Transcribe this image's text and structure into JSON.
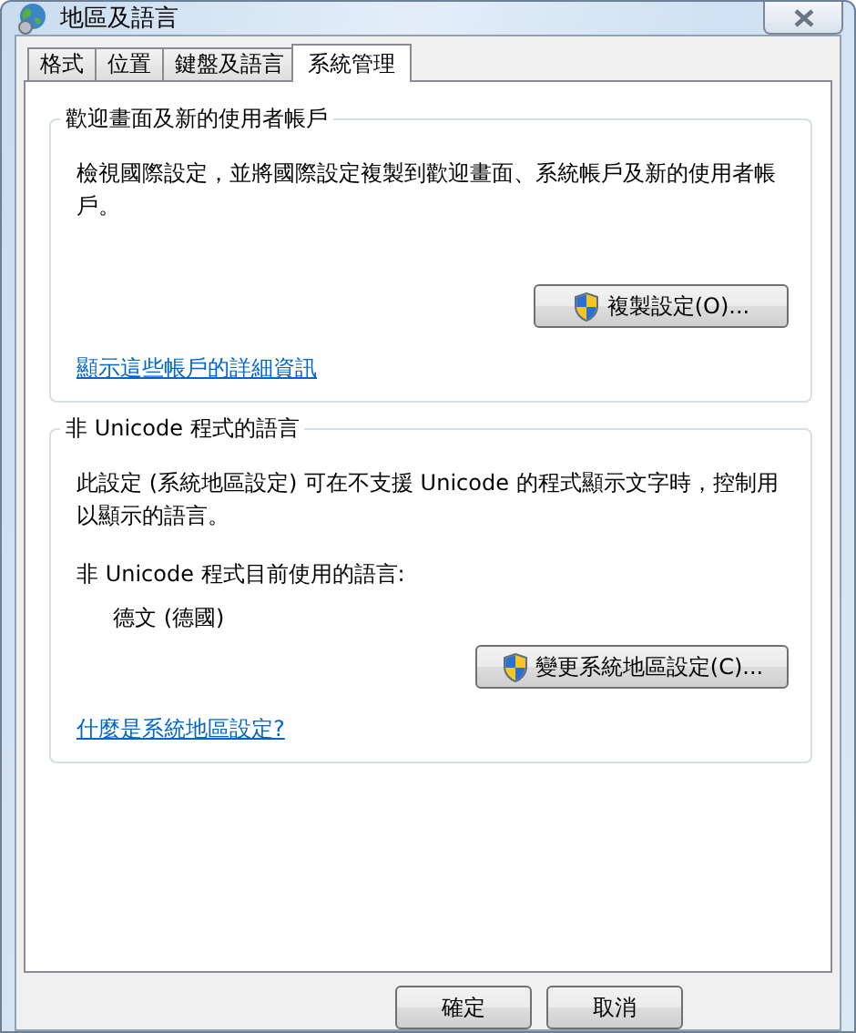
{
  "window": {
    "title": "地區及語言"
  },
  "tabs": [
    {
      "label": "格式",
      "selected": false
    },
    {
      "label": "位置",
      "selected": false
    },
    {
      "label": "鍵盤及語言",
      "selected": false
    },
    {
      "label": "系統管理",
      "selected": true
    }
  ],
  "groups": [
    {
      "title": "歡迎畫面及新的使用者帳戶",
      "items": [
        {
          "kind": "text",
          "text": "檢視國際設定，並將國際設定複製到歡迎畫面、系統帳戶及新的使用者帳戶。"
        },
        {
          "kind": "button",
          "label": "複製設定(O)...",
          "shield": true
        },
        {
          "kind": "link",
          "text": "顯示這些帳戶的詳細資訊"
        }
      ]
    },
    {
      "title": "非 Unicode 程式的語言",
      "items": [
        {
          "kind": "text",
          "text": "此設定 (系統地區設定) 可在不支援 Unicode 的程式顯示文字時，控制用以顯示的語言。"
        },
        {
          "kind": "label",
          "text": "非 Unicode 程式目前使用的語言:"
        },
        {
          "kind": "value",
          "text": "德文 (德國)"
        },
        {
          "kind": "button",
          "label": "變更系統地區設定(C)...",
          "shield": true
        },
        {
          "kind": "link",
          "text": "什麼是系統地區設定?"
        }
      ]
    }
  ],
  "buttons": [
    {
      "label": "確定"
    },
    {
      "label": "取消"
    }
  ]
}
